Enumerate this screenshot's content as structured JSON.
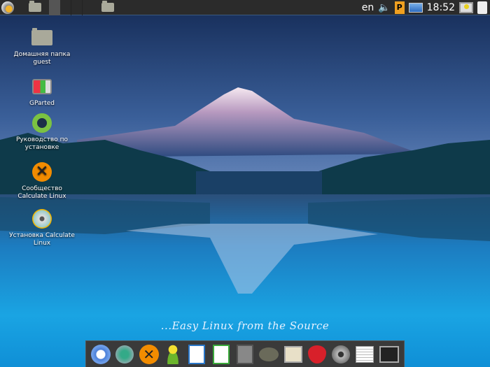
{
  "topbar": {
    "language": "en",
    "clock": "18:52"
  },
  "desktop_icons": [
    {
      "label": "Домашняя папка guest",
      "icon": "home-folder-icon"
    },
    {
      "label": "GParted",
      "icon": "gparted-icon"
    },
    {
      "label": "Руководство по установке",
      "icon": "lifebuoy-icon"
    },
    {
      "label": "Сообщество Calculate Linux",
      "icon": "calculate-logo-icon"
    },
    {
      "label": "Установка Calculate Linux",
      "icon": "installer-cd-icon"
    }
  ],
  "slogan": "...Easy Linux from the Source",
  "dock": [
    "chromium",
    "mail-client",
    "calculate",
    "messenger",
    "writer",
    "calc-spreadsheet",
    "calculator",
    "gimp",
    "image-viewer",
    "strawberry-player",
    "video-player",
    "text-editor",
    "terminal"
  ],
  "colors": {
    "panel": "#2b2b2b",
    "accent": "#3c5a80"
  }
}
